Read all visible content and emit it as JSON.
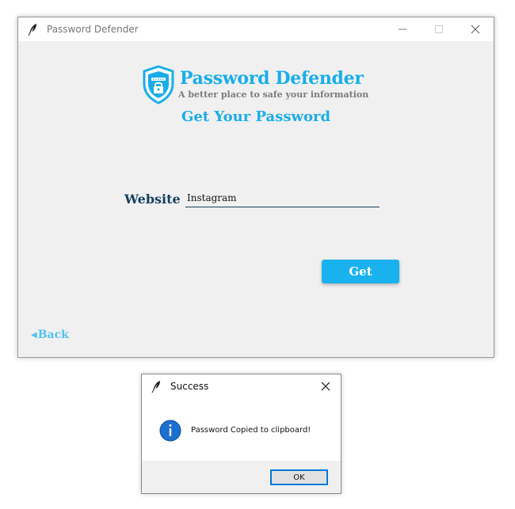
{
  "main_window": {
    "title": "Password Defender",
    "controls": {
      "minimize": "minimize-icon",
      "maximize": "maximize-icon",
      "close": "close-icon"
    },
    "brand": {
      "title": "Password Defender",
      "subtitle": "A better place to safe your information"
    },
    "heading": "Get Your Password",
    "form": {
      "website_label": "Website :",
      "website_value": "Instagram",
      "get_button": "Get"
    },
    "back_link": "Back",
    "colors": {
      "accent": "#19aee8",
      "label": "#14405c",
      "button": "#1ab2ee"
    }
  },
  "dialog": {
    "title": "Success",
    "message": "Password Copied to clipboard!",
    "ok_button": "OK",
    "icon": "info-icon"
  }
}
